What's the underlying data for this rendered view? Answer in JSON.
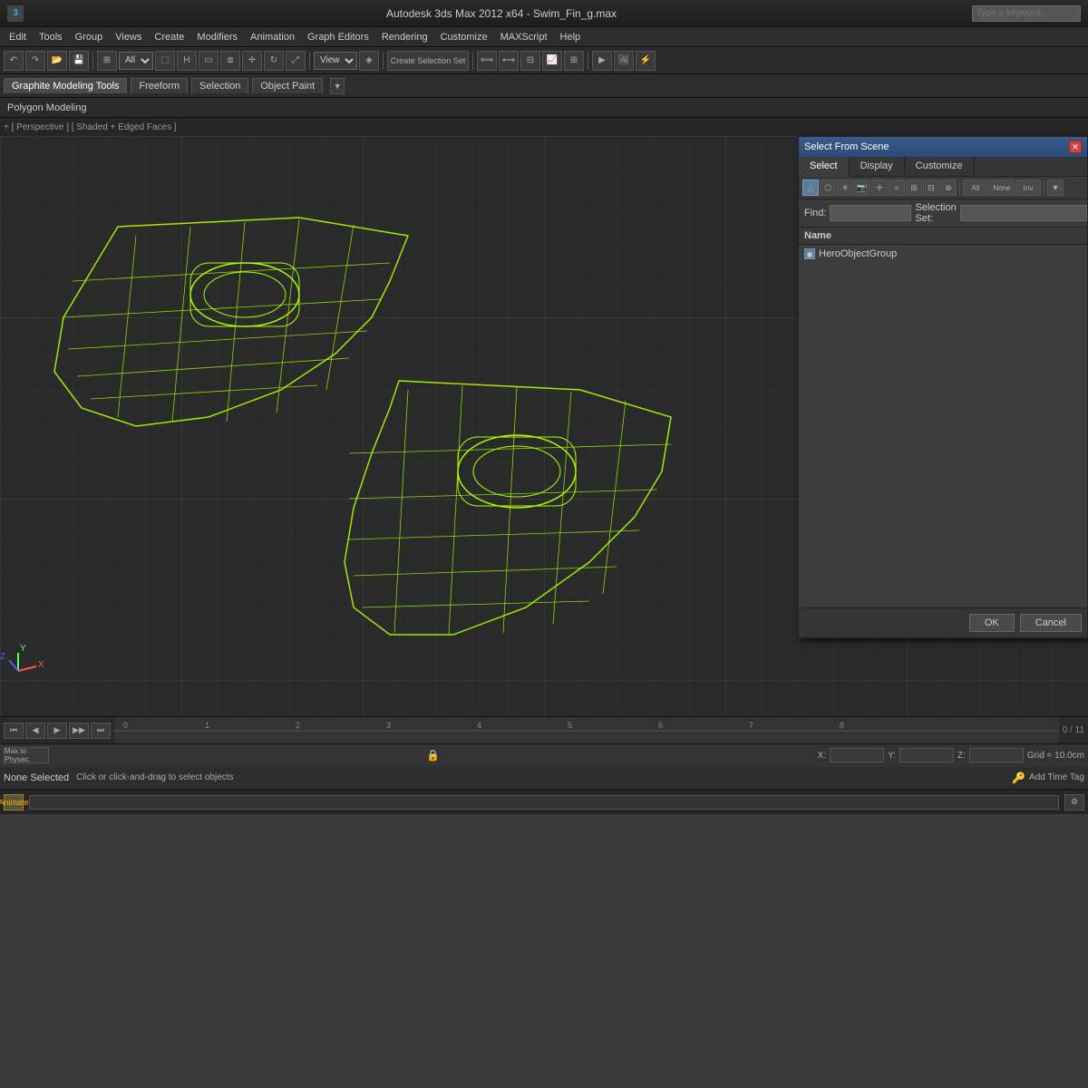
{
  "titlebar": {
    "logo": "3",
    "title": "Autodesk 3ds Max 2012 x64 - Swim_Fin_g.max",
    "search_placeholder": "Type a keyword..."
  },
  "menubar": {
    "items": [
      "Edit",
      "Tools",
      "Group",
      "Views",
      "Create",
      "Modifiers",
      "Animation",
      "Graph Editors",
      "Rendering",
      "Customize",
      "MAXScript",
      "Help"
    ]
  },
  "toolbar": {
    "filter_label": "All",
    "view_label": "View"
  },
  "toolbar2": {
    "tabs": [
      "Graphite Modeling Tools",
      "Freeform",
      "Selection",
      "Object Paint"
    ],
    "active_tab": "Graphite Modeling Tools"
  },
  "subtoolbar": {
    "label": "Polygon Modeling"
  },
  "viewport": {
    "label": "+ [ Perspective ] [ Shaded + Edged Faces ]"
  },
  "dialog": {
    "title": "Select From Scene",
    "tabs": [
      "Select",
      "Display",
      "Customize"
    ],
    "active_tab": "Select",
    "find_label": "Find:",
    "find_value": "",
    "selset_label": "Selection Set:",
    "selset_value": "",
    "name_header": "Name",
    "objects": [
      {
        "name": "HeroObjectGroup",
        "icon": "▣"
      }
    ],
    "ok_label": "OK",
    "cancel_label": "Cancel"
  },
  "status": {
    "none_selected": "None Selected",
    "hint": "Click or click-and-drag to select objects",
    "x_label": "X:",
    "y_label": "Y:",
    "z_label": "Z:",
    "x_value": "",
    "y_value": "",
    "z_value": "",
    "grid_label": "Grid = 10.0cm",
    "add_time_tag": "Add Time Tag",
    "frame_count": "0 / 11"
  },
  "colors": {
    "wireframe": "#aaff00",
    "grid": "#444444",
    "background": "#2a2a2a",
    "dialog_header": "#3a5a8a"
  }
}
